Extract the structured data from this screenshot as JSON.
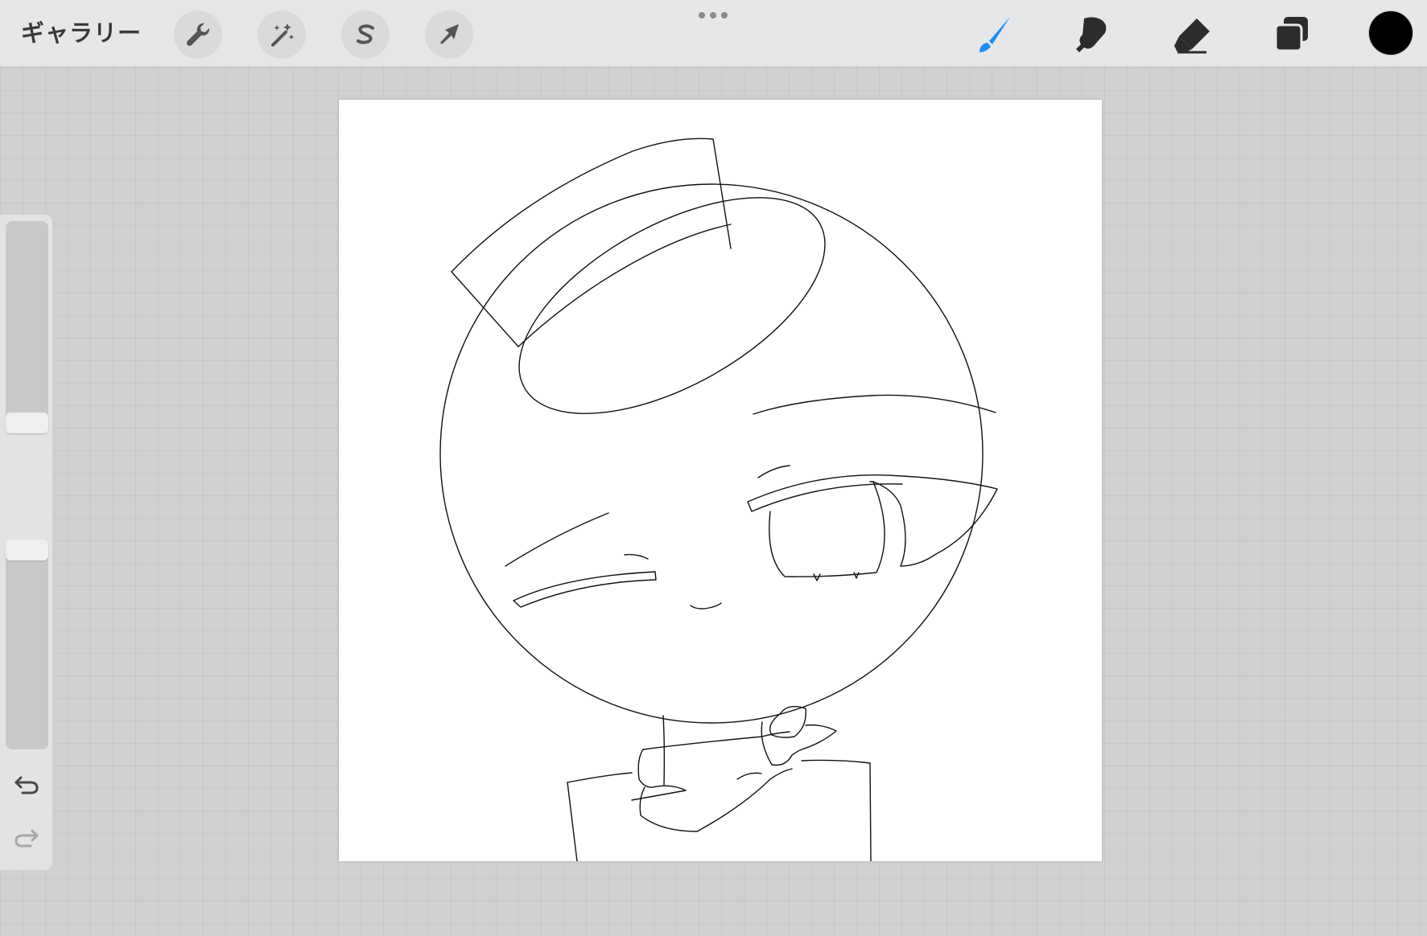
{
  "toolbar": {
    "gallery_label": "ギャラリー",
    "left_tools": [
      {
        "name": "actions",
        "icon": "wrench-icon"
      },
      {
        "name": "adjustments",
        "icon": "magic-wand-icon"
      },
      {
        "name": "selection",
        "icon": "selection-s-icon"
      },
      {
        "name": "transform",
        "icon": "arrow-cursor-icon"
      }
    ],
    "right_tools": [
      {
        "name": "brush",
        "icon": "brush-icon",
        "active": true
      },
      {
        "name": "smudge",
        "icon": "smudge-finger-icon",
        "active": false
      },
      {
        "name": "eraser",
        "icon": "eraser-icon",
        "active": false
      },
      {
        "name": "layers",
        "icon": "layers-icon",
        "active": false
      }
    ],
    "current_color": "#000000",
    "accent_color": "#1f8ef1"
  },
  "sidebar": {
    "brush_size_level": 0.0,
    "opacity_level": 1.0,
    "modify_icon": "square-modify-icon",
    "undo_icon": "undo-icon",
    "redo_icon": "redo-icon",
    "redo_enabled": false
  },
  "canvas": {
    "background": "#ffffff",
    "content": "line-sketch"
  }
}
